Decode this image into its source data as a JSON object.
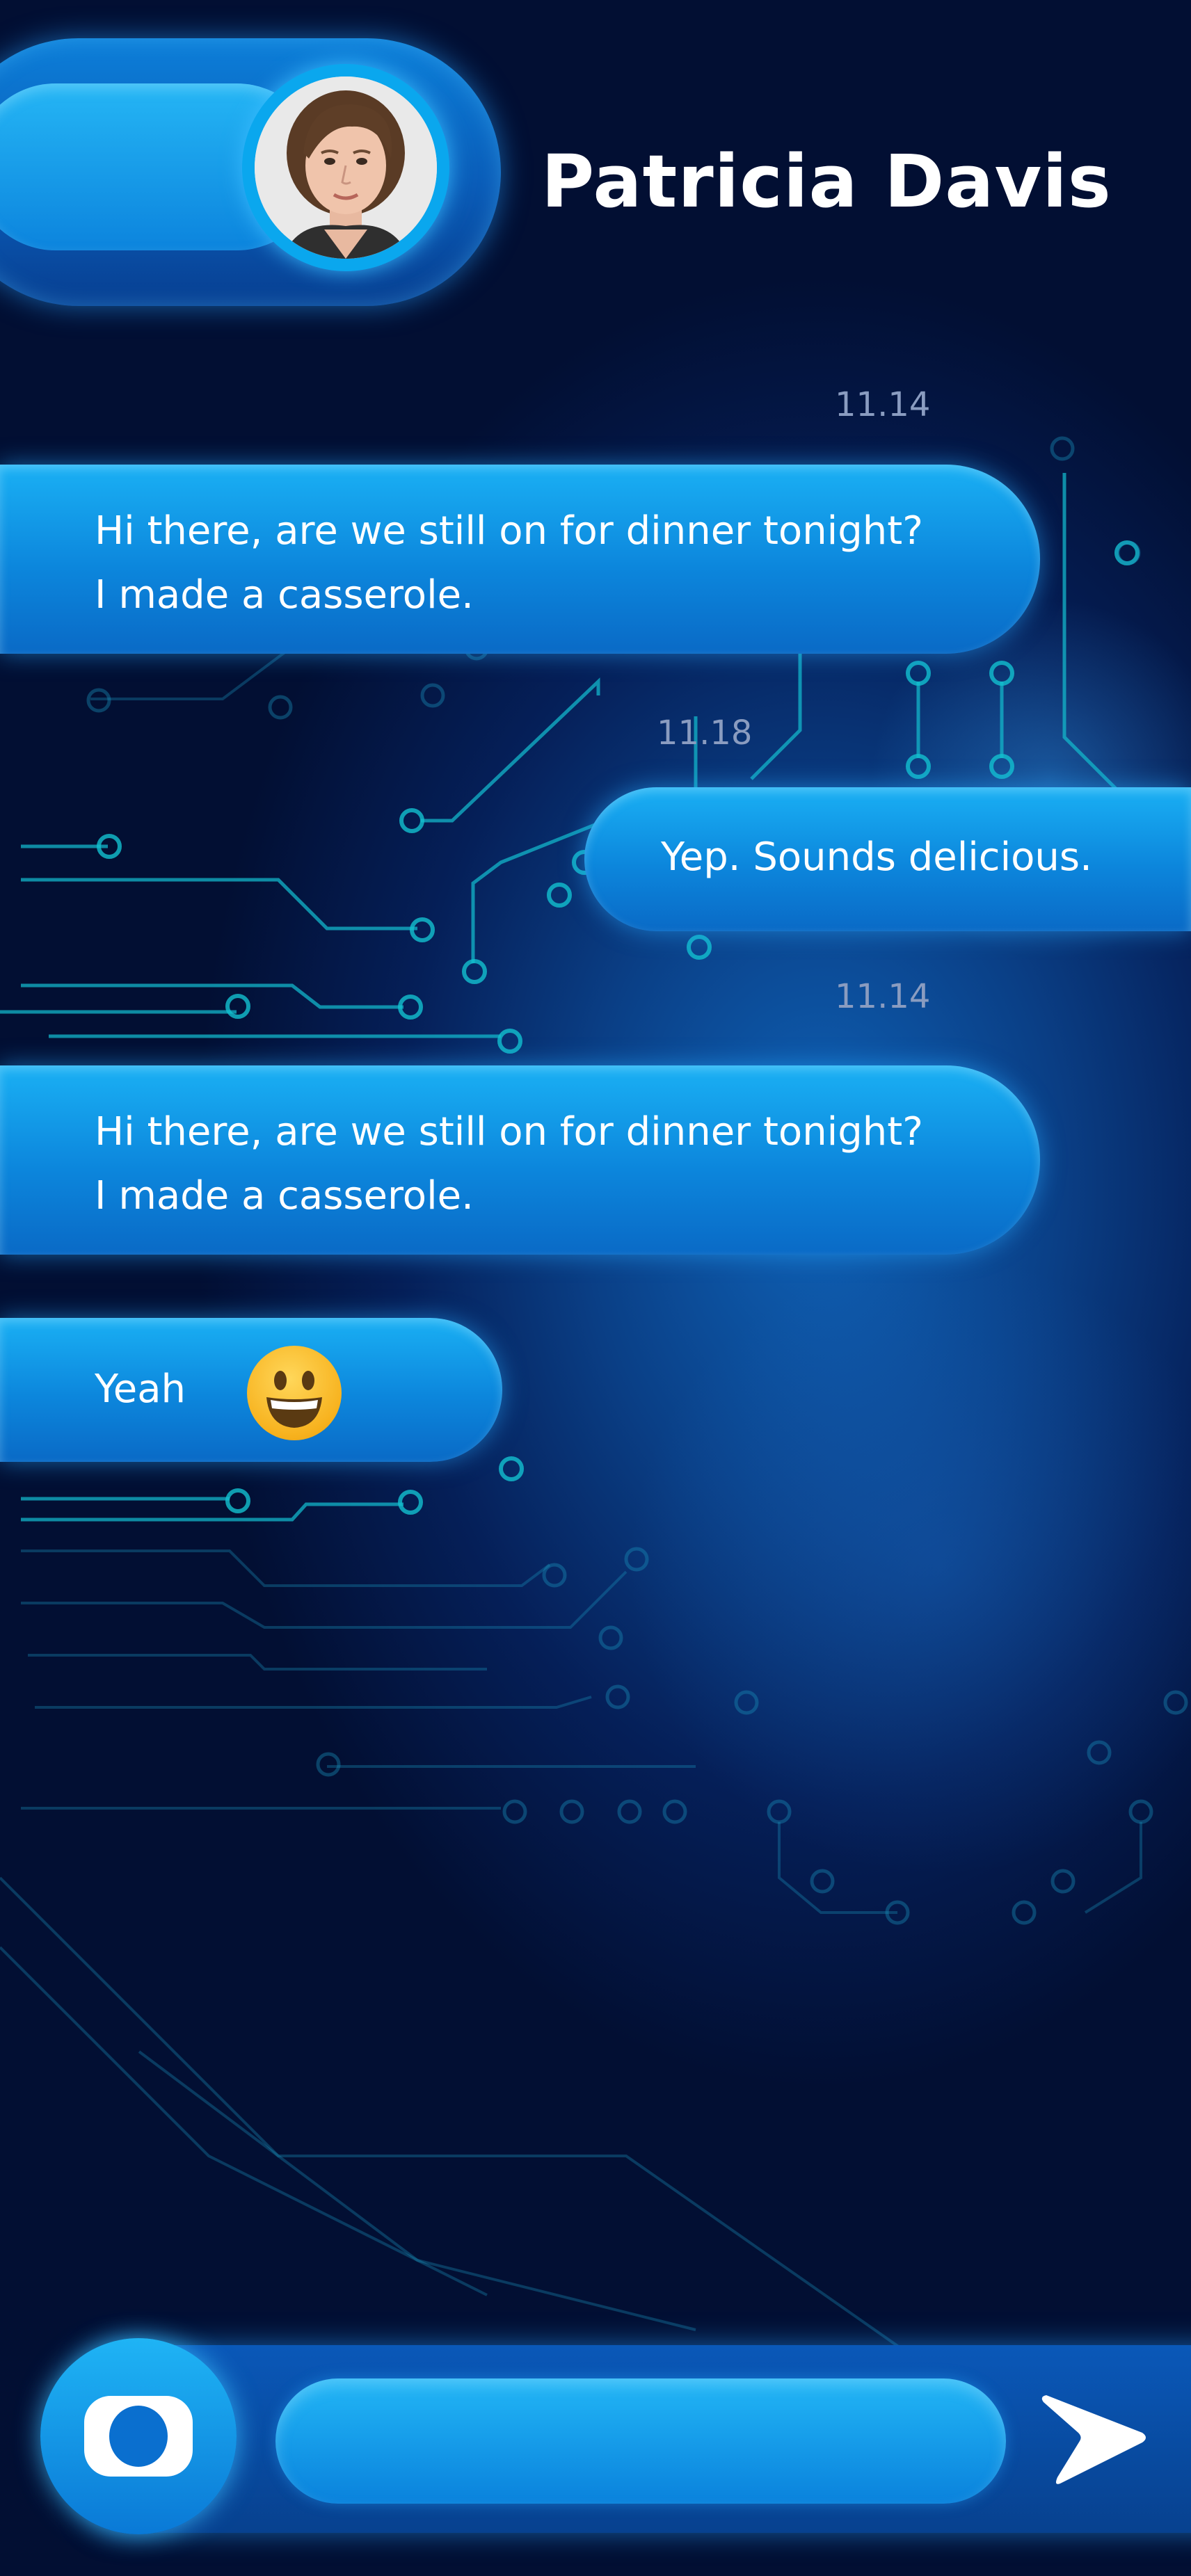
{
  "contact": {
    "name": "Patricia Davis"
  },
  "messages": [
    {
      "time": "11.14",
      "direction": "incoming",
      "lines": [
        "Hi there, are we still on for dinner tonight?",
        "I made a casserole."
      ]
    },
    {
      "time": "11.18",
      "direction": "outgoing",
      "lines": [
        "Yep. Sounds delicious."
      ]
    },
    {
      "time": "11.14",
      "direction": "incoming",
      "lines": [
        "Hi there, are we still on for dinner tonight?",
        "I made a casserole."
      ]
    },
    {
      "direction": "incoming",
      "lines": [
        "Yeah"
      ],
      "emoji": "grinning-face-emoji"
    }
  ],
  "composer": {
    "value": "",
    "placeholder": "",
    "camera_icon": "camera-icon",
    "send_icon": "send-arrow-icon"
  },
  "theme": {
    "accent": "#1ab0f4",
    "background": "#051f58",
    "timestamp": "#8a9cc0",
    "text": "#ffffff"
  }
}
